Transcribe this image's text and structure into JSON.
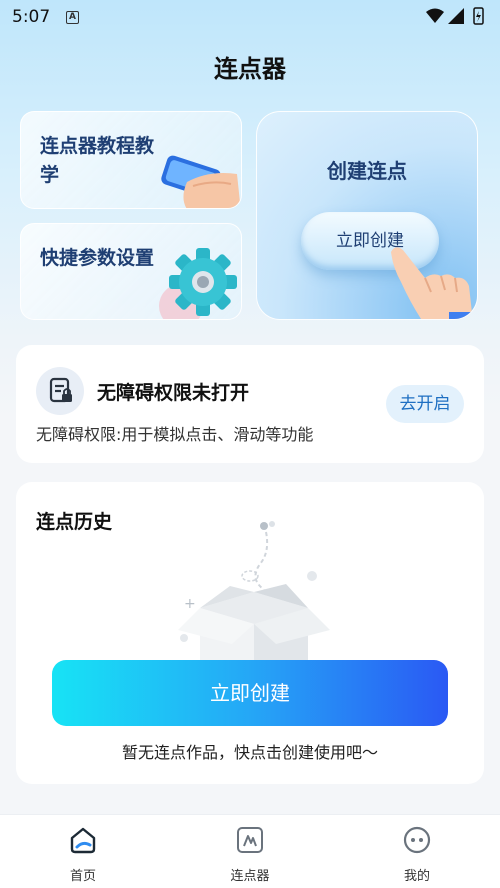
{
  "status_bar": {
    "time": "5:07",
    "notification_icon": "A"
  },
  "header": {
    "title": "连点器"
  },
  "tiles": {
    "tutorial_label": "连点器教程教学",
    "settings_label": "快捷参数设置",
    "create_title": "创建连点",
    "create_button": "立即创建"
  },
  "permission": {
    "title": "无障碍权限未打开",
    "description": "无障碍权限:用于模拟点击、滑动等功能",
    "button": "去开启"
  },
  "history": {
    "title": "连点历史",
    "create_button": "立即创建",
    "empty_text": "暂无连点作品，快点击创建使用吧～"
  },
  "bottom_nav": {
    "items": [
      {
        "label": "首页",
        "icon": "home-icon",
        "active": true
      },
      {
        "label": "连点器",
        "icon": "clicker-icon",
        "active": false
      },
      {
        "label": "我的",
        "icon": "profile-icon",
        "active": false
      }
    ]
  },
  "colors": {
    "accent": "#1e6fc2",
    "tile_text": "#1f3f73",
    "button_gradient_start": "#17e3f5",
    "button_gradient_end": "#2a59f4"
  }
}
